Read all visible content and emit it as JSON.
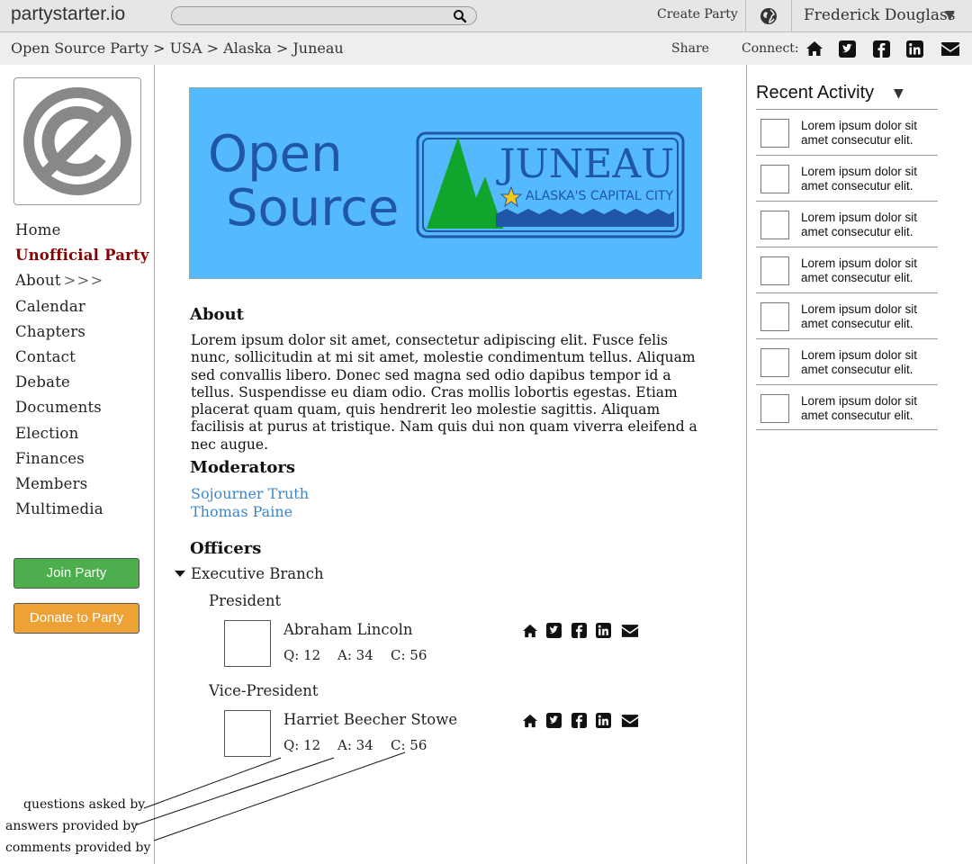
{
  "topbar": {
    "logo": "partystarter.io",
    "search_placeholder": "",
    "create_party": "Create Party",
    "user_name": "Frederick Douglass",
    "user_caret": "▼",
    "icons": [
      "search-icon",
      "globe-icon"
    ]
  },
  "breadcrumb": {
    "path": "Open Source Party > USA > Alaska > Juneau",
    "share": "Share",
    "connect": "Connect:",
    "connect_icons": [
      "home-icon",
      "twitter-icon",
      "facebook-icon",
      "linkedin-icon",
      "email-icon"
    ]
  },
  "sidebar": {
    "nav": [
      {
        "label": "Home"
      },
      {
        "label": "Unofficial Party",
        "active": true
      },
      {
        "label": "About",
        "suffix": ">>>"
      },
      {
        "label": "Calendar"
      },
      {
        "label": "Chapters"
      },
      {
        "label": "Contact"
      },
      {
        "label": "Debate"
      },
      {
        "label": "Documents"
      },
      {
        "label": "Election"
      },
      {
        "label": "Finances"
      },
      {
        "label": "Members"
      },
      {
        "label": "Multimedia"
      }
    ],
    "join_button": "Join Party",
    "donate_button": "Donate to Party",
    "colors": {
      "join": "#4cae4c",
      "donate": "#eea236",
      "active": "#8b0000"
    }
  },
  "banner": {
    "line1": "Open",
    "line2": "Source",
    "city": "JUNEAU",
    "tagline": "ALASKA'S CAPITAL CITY",
    "background": "#54b9fd"
  },
  "about": {
    "title": "About",
    "text": "Lorem ipsum dolor sit amet, consectetur adipiscing elit. Fusce felis nunc, sollicitudin at mi sit amet, molestie condimentum tellus. Aliquam sed convallis libero. Donec sed magna sed odio dapibus tempor id a tellus. Suspendisse eu diam odio. Cras mollis lobortis egestas. Etiam placerat quam quam, quis hendrerit leo molestie sagittis. Aliquam facilisis at purus at tristique. Nam quis dui non quam viverra eleifend a nec augue."
  },
  "moderators": {
    "title": "Moderators",
    "names": [
      "Sojourner Truth",
      "Thomas Paine"
    ]
  },
  "officers": {
    "title": "Officers",
    "branch": "Executive Branch",
    "roles": [
      {
        "role": "President",
        "name": "Abraham Lincoln",
        "q": "Q: 12",
        "a": "A: 34",
        "c": "C: 56"
      },
      {
        "role": "Vice-President",
        "name": "Harriet Beecher Stowe",
        "q": "Q: 12",
        "a": "A: 34",
        "c": "C: 56"
      }
    ]
  },
  "annotations": {
    "questions": "questions asked by",
    "answers": "answers provided by",
    "comments": "comments provided by"
  },
  "recent": {
    "title": "Recent Activity",
    "caret": "▼",
    "items": [
      "Lorem ipsum dolor sit amet consecutur elit.",
      "Lorem ipsum dolor sit amet consecutur elit.",
      "Lorem ipsum dolor sit amet consecutur elit.",
      "Lorem ipsum dolor sit amet consecutur elit.",
      "Lorem ipsum dolor sit amet consecutur elit.",
      "Lorem ipsum dolor sit amet consecutur elit.",
      "Lorem ipsum dolor sit amet consecutur elit."
    ]
  }
}
